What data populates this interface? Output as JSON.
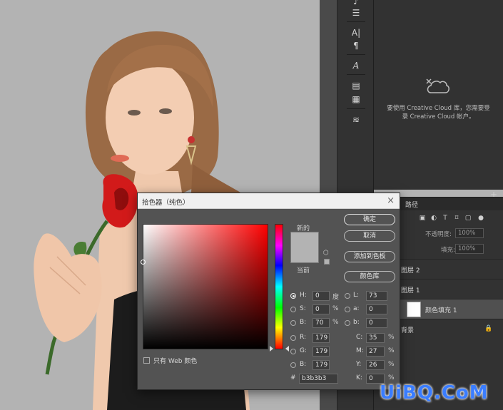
{
  "toolbar": {
    "icons": [
      "tool-icon",
      "adjust-icon",
      "character-icon",
      "paragraph-icon",
      "glyph-icon",
      "library-icon",
      "notes-icon",
      "properties-icon"
    ],
    "character_label": "A|",
    "paragraph_label": "¶",
    "glyphs_label": "A"
  },
  "libraries": {
    "message": "要使用 Creative Cloud 库，您需要登录 Creative Cloud 帐户。",
    "message_line1": "要使用 Creative Cloud 库，您需要登",
    "message_line2": "录 Creative Cloud 帐户。"
  },
  "layers": {
    "tab_paths": "路径",
    "opacity_label": "不透明度:",
    "opacity_value": "100%",
    "fill_label": "填充:",
    "fill_value": "100%",
    "items": [
      {
        "name": "图层 2"
      },
      {
        "name": "图层 1"
      },
      {
        "name": "颜色填充 1"
      },
      {
        "name": "背景"
      }
    ]
  },
  "dialog": {
    "title": "拾色器（纯色）",
    "close": "×",
    "new_label": "新的",
    "current_label": "当前",
    "buttons": {
      "ok": "确定",
      "cancel": "取消",
      "add_swatch": "添加到色板",
      "color_library": "颜色库"
    },
    "web_only": "只有 Web 颜色",
    "fields": {
      "H": {
        "label": "H:",
        "value": "0",
        "unit": "度"
      },
      "S": {
        "label": "S:",
        "value": "0",
        "unit": "%"
      },
      "B": {
        "label": "B:",
        "value": "70",
        "unit": "%"
      },
      "R": {
        "label": "R:",
        "value": "179"
      },
      "G": {
        "label": "G:",
        "value": "179"
      },
      "Bl": {
        "label": "B:",
        "value": "179"
      },
      "L": {
        "label": "L:",
        "value": "73"
      },
      "a": {
        "label": "a:",
        "value": "0"
      },
      "b": {
        "label": "b:",
        "value": "0"
      },
      "C": {
        "label": "C:",
        "value": "35",
        "unit": "%"
      },
      "M": {
        "label": "M:",
        "value": "27",
        "unit": "%"
      },
      "Y": {
        "label": "Y:",
        "value": "26",
        "unit": "%"
      },
      "K": {
        "label": "K:",
        "value": "0",
        "unit": "%"
      }
    },
    "hex_label": "#",
    "hex_value": "b3b3b3",
    "color": "#b3b3b3"
  },
  "watermark": "UiBQ.CoM"
}
